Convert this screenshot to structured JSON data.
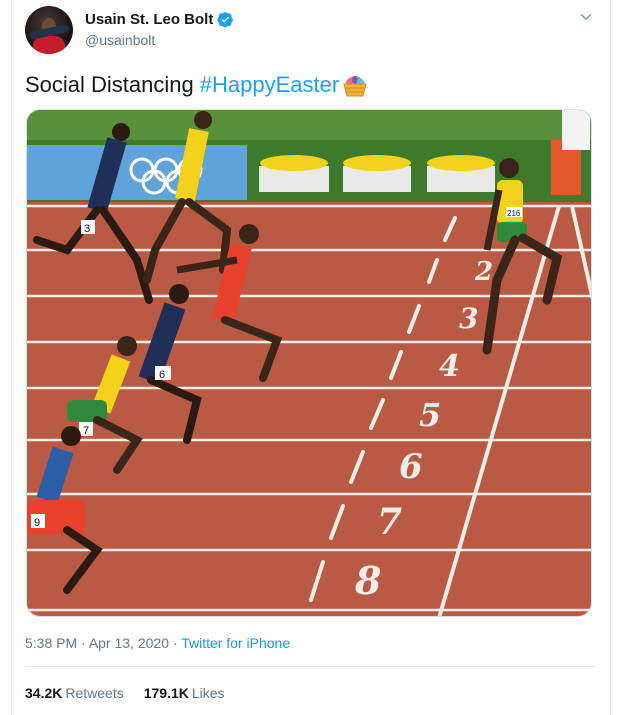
{
  "user": {
    "display_name": "Usain St. Leo Bolt",
    "handle": "@usainbolt",
    "verified": true,
    "avatar_icon": "avatar"
  },
  "tweet": {
    "text": "Social Distancing",
    "hashtag": "#HappyEaster",
    "emoji_icon": "easter-basket-icon"
  },
  "photo": {
    "lane_numbers": [
      "2",
      "3",
      "4",
      "5",
      "6",
      "7",
      "8"
    ],
    "bibs": [
      "3",
      "216",
      "6",
      "9",
      "7"
    ]
  },
  "meta": {
    "time": "5:38 PM",
    "sep1": " · ",
    "date": "Apr 13, 2020",
    "sep2": " · ",
    "source": "Twitter for iPhone"
  },
  "stats": {
    "retweets_count": "34.2K",
    "retweets_label": "Retweets",
    "likes_count": "179.1K",
    "likes_label": "Likes"
  },
  "colors": {
    "hashtag": "#1da1f2",
    "verified": "#1da1f2",
    "track": "#b85a44",
    "grass": "#3e7a2c"
  }
}
